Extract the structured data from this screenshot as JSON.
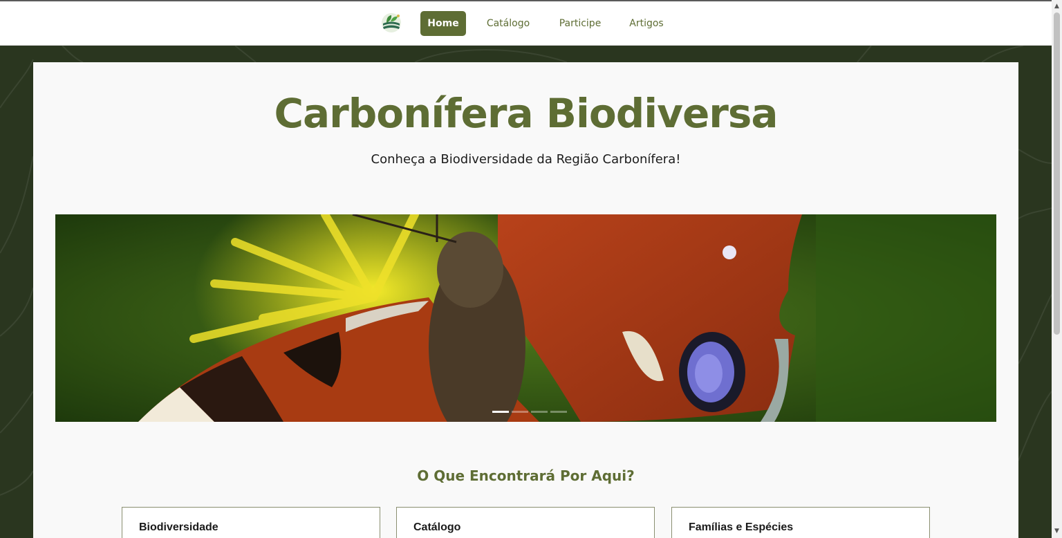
{
  "nav": {
    "logo_icon": "leaf-globe-logo-icon",
    "items": [
      {
        "label": "Home",
        "active": true
      },
      {
        "label": "Catálogo",
        "active": false
      },
      {
        "label": "Participe",
        "active": false
      },
      {
        "label": "Artigos",
        "active": false
      }
    ]
  },
  "hero": {
    "title": "Carbonífera Biodiversa",
    "subtitle": "Conheça a Biodiversidade da Região Carbonífera!"
  },
  "carousel": {
    "image_subject": "butterfly on yellow flower",
    "slides": 4,
    "active_slide": 1
  },
  "features": {
    "title": "O Que Encontrará Por Aqui?",
    "cards": [
      {
        "label": "Biodiversidade"
      },
      {
        "label": "Catálogo"
      },
      {
        "label": "Famílias e Espécies"
      }
    ]
  },
  "colors": {
    "brand": "#5e6d34",
    "background": "#2a361f",
    "card": "#f9f9f9"
  }
}
